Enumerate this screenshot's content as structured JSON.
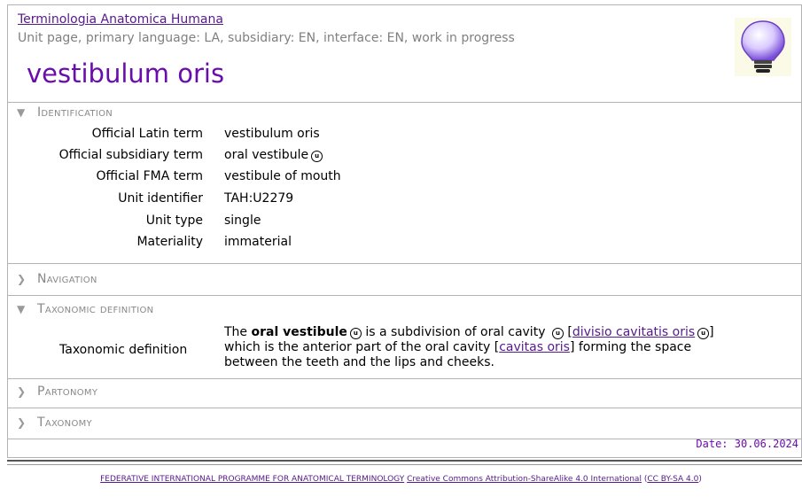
{
  "header": {
    "title_link": "Terminologia Anatomica Humana",
    "subtitle": "Unit page, primary language: LA, subsidiary: EN, interface: EN, work in progress",
    "unit_name": "vestibulum oris",
    "icon": "lightbulb-icon"
  },
  "sections": {
    "identification": "Identification",
    "navigation": "Navigation",
    "taxonomic_definition": "Taxonomic definition",
    "partonomy": "Partonomy",
    "taxonomy": "Taxonomy"
  },
  "identification": [
    {
      "key": "Official Latin term",
      "value": "vestibulum oris"
    },
    {
      "key": "Official subsidiary term",
      "value": "oral vestibule"
    },
    {
      "key": "Official FMA term",
      "value": "vestibule of mouth"
    },
    {
      "key": "Unit identifier",
      "value": "TAH:U2279"
    },
    {
      "key": "Unit type",
      "value": "single"
    },
    {
      "key": "Materiality",
      "value": "immaterial"
    }
  ],
  "definition": {
    "label": "Taxonomic definition",
    "t1": "The ",
    "bold": "oral vestibule",
    "t2": " is a subdivision of oral cavity ",
    "t3": " [",
    "link1": "divisio cavitatis oris",
    "t4": "]",
    "t5": "which is the anterior part of the oral cavity [",
    "link2": "cavitas oris",
    "t6": "] forming the space",
    "t7": "between the teeth and the lips and cheeks."
  },
  "date": "Date: 30.06.2024",
  "footer": {
    "org": "FEDERATIVE INTERNATIONAL PROGRAMME FOR ANATOMICAL TERMINOLOGY",
    "license": "Creative Commons Attribution-ShareAlike 4.0 International",
    "short_open": "(",
    "short": "CC BY-SA 4.0",
    "short_close": ")"
  },
  "noto_symbol": "u"
}
